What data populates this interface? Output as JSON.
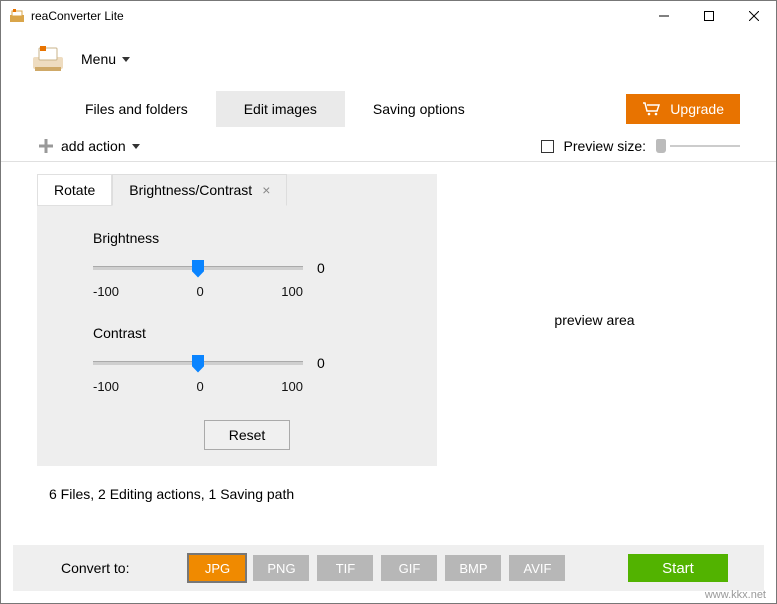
{
  "window": {
    "title": "reaConverter Lite"
  },
  "menu": {
    "label": "Menu"
  },
  "main_tabs": {
    "files": "Files and folders",
    "edit": "Edit images",
    "saving": "Saving options"
  },
  "upgrade": {
    "label": "Upgrade"
  },
  "toolbar": {
    "add_action": "add action",
    "preview_size": "Preview size:"
  },
  "panel_tabs": {
    "rotate": "Rotate",
    "brightness_contrast": "Brightness/Contrast"
  },
  "sliders": {
    "brightness": {
      "label": "Brightness",
      "value": "0",
      "tick_min": "-100",
      "tick_mid": "0",
      "tick_max": "100"
    },
    "contrast": {
      "label": "Contrast",
      "value": "0",
      "tick_min": "-100",
      "tick_mid": "0",
      "tick_max": "100"
    },
    "reset": "Reset"
  },
  "preview": {
    "text": "preview area"
  },
  "status": {
    "text": "6 Files, 2 Editing actions, 1 Saving path"
  },
  "bottom": {
    "convert_to": "Convert to:",
    "formats": {
      "jpg": "JPG",
      "png": "PNG",
      "tif": "TIF",
      "gif": "GIF",
      "bmp": "BMP",
      "avif": "AVIF"
    },
    "start": "Start"
  },
  "watermark": "www.kkx.net"
}
